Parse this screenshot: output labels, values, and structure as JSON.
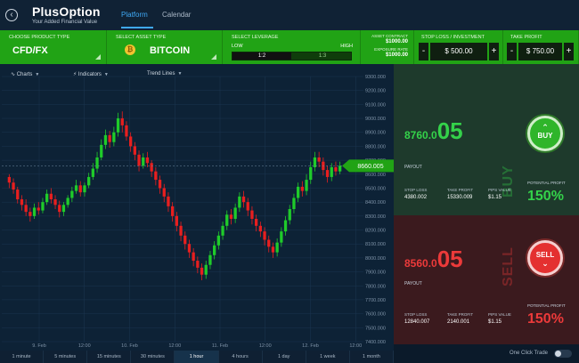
{
  "header": {
    "logo_name": "PlusOption",
    "logo_tagline": "Your Added Financial Value",
    "tabs": [
      {
        "label": "Platform",
        "active": true
      },
      {
        "label": "Calendar",
        "active": false
      }
    ]
  },
  "controls": {
    "product": {
      "label": "CHOOSE PRODUCT TYPE",
      "value": "CFD/FX"
    },
    "asset": {
      "label": "SELECT ASSET TYPE",
      "value": "BITCOIN",
      "icon": "bitcoin-coin-icon"
    },
    "leverage": {
      "label": "SELECT LEVERAGE",
      "low": "LOW",
      "high": "HIGH",
      "selected": "1:2",
      "other": "1:3"
    },
    "asset_contract": {
      "label": "ASSET CONTRACT",
      "value": "$1000.00",
      "exposure_label": "EXPOSURE RATE",
      "exposure_value": "$1000.00"
    },
    "stop_loss": {
      "label": "STOP LOSS / INVESTMENT",
      "value": "$ 500.00",
      "minus": "-",
      "plus": "+"
    },
    "take_profit": {
      "label": "TAKE PROFIT",
      "value": "$ 750.00",
      "minus": "-",
      "plus": "+"
    }
  },
  "toolbar": {
    "charts": "Charts",
    "indicators": "Indicators",
    "trend_lines": "Trend Lines"
  },
  "chart_data": {
    "type": "candlestick",
    "y_ticks": [
      "9300.000",
      "9200.000",
      "9100.000",
      "9000.000",
      "8900.000",
      "8800.000",
      "8700.000",
      "8600.000",
      "8500.000",
      "8400.000",
      "8300.000",
      "8200.000",
      "8100.000",
      "8000.000",
      "7900.000",
      "7800.000",
      "7700.000",
      "7600.000",
      "7500.000",
      "7400.000"
    ],
    "x_ticks": [
      "9. Feb",
      "12:00",
      "10. Feb",
      "12:00",
      "11. Feb",
      "12:00",
      "12. Feb",
      "12:00"
    ],
    "ylim": [
      7400,
      9300
    ],
    "current_price": "8660.005",
    "colors": {
      "up": "#1fcb2a",
      "down": "#e81f1f",
      "marker": "#21a315"
    },
    "candles": [
      [
        8580,
        8540,
        8600,
        8500
      ],
      [
        8540,
        8490,
        8570,
        8460
      ],
      [
        8490,
        8420,
        8510,
        8390
      ],
      [
        8420,
        8380,
        8450,
        8340
      ],
      [
        8380,
        8330,
        8420,
        8300
      ],
      [
        8330,
        8300,
        8360,
        8260
      ],
      [
        8300,
        8360,
        8390,
        8280
      ],
      [
        8360,
        8340,
        8400,
        8310
      ],
      [
        8340,
        8400,
        8430,
        8320
      ],
      [
        8400,
        8460,
        8490,
        8380
      ],
      [
        8460,
        8420,
        8500,
        8390
      ],
      [
        8420,
        8380,
        8450,
        8350
      ],
      [
        8380,
        8330,
        8410,
        8290
      ],
      [
        8330,
        8380,
        8400,
        8300
      ],
      [
        8380,
        8430,
        8450,
        8360
      ],
      [
        8430,
        8480,
        8510,
        8400
      ],
      [
        8480,
        8520,
        8560,
        8460
      ],
      [
        8520,
        8470,
        8550,
        8440
      ],
      [
        8470,
        8520,
        8540,
        8440
      ],
      [
        8520,
        8580,
        8610,
        8500
      ],
      [
        8580,
        8640,
        8680,
        8560
      ],
      [
        8640,
        8720,
        8760,
        8610
      ],
      [
        8720,
        8810,
        8850,
        8700
      ],
      [
        8810,
        8880,
        8920,
        8780
      ],
      [
        8880,
        8830,
        8910,
        8790
      ],
      [
        8830,
        8900,
        8940,
        8800
      ],
      [
        8900,
        9000,
        9040,
        8870
      ],
      [
        9000,
        8950,
        9050,
        8900
      ],
      [
        8950,
        8870,
        8980,
        8840
      ],
      [
        8870,
        8800,
        8900,
        8760
      ],
      [
        8800,
        8740,
        8830,
        8700
      ],
      [
        8740,
        8660,
        8770,
        8620
      ],
      [
        8660,
        8720,
        8750,
        8640
      ],
      [
        8720,
        8680,
        8760,
        8650
      ],
      [
        8680,
        8620,
        8700,
        8580
      ],
      [
        8620,
        8560,
        8650,
        8520
      ],
      [
        8560,
        8500,
        8590,
        8460
      ],
      [
        8500,
        8440,
        8530,
        8400
      ],
      [
        8440,
        8370,
        8470,
        8330
      ],
      [
        8370,
        8300,
        8400,
        8260
      ],
      [
        8300,
        8230,
        8330,
        8190
      ],
      [
        8230,
        8160,
        8260,
        8120
      ],
      [
        8160,
        8100,
        8190,
        8060
      ],
      [
        8100,
        8040,
        8130,
        8000
      ],
      [
        8040,
        7980,
        8070,
        7940
      ],
      [
        7980,
        7930,
        8010,
        7890
      ],
      [
        7930,
        7880,
        7960,
        7840
      ],
      [
        7880,
        7950,
        7980,
        7850
      ],
      [
        7950,
        8020,
        8050,
        7920
      ],
      [
        8020,
        8090,
        8120,
        7990
      ],
      [
        8090,
        8160,
        8190,
        8060
      ],
      [
        8160,
        8230,
        8260,
        8130
      ],
      [
        8230,
        8310,
        8340,
        8200
      ],
      [
        8310,
        8280,
        8350,
        8240
      ],
      [
        8280,
        8360,
        8390,
        8250
      ],
      [
        8360,
        8440,
        8470,
        8330
      ],
      [
        8440,
        8400,
        8480,
        8360
      ],
      [
        8400,
        8340,
        8430,
        8300
      ],
      [
        8340,
        8280,
        8370,
        8240
      ],
      [
        8280,
        8230,
        8310,
        8190
      ],
      [
        8230,
        8190,
        8260,
        8150
      ],
      [
        8190,
        8130,
        8220,
        8090
      ],
      [
        8130,
        8080,
        8160,
        8040
      ],
      [
        8080,
        8040,
        8110,
        8000
      ],
      [
        8040,
        8110,
        8140,
        8010
      ],
      [
        8110,
        8190,
        8220,
        8080
      ],
      [
        8190,
        8270,
        8300,
        8160
      ],
      [
        8270,
        8350,
        8380,
        8240
      ],
      [
        8350,
        8430,
        8460,
        8320
      ],
      [
        8430,
        8510,
        8540,
        8400
      ],
      [
        8510,
        8480,
        8550,
        8440
      ],
      [
        8480,
        8560,
        8600,
        8450
      ],
      [
        8560,
        8650,
        8690,
        8530
      ],
      [
        8650,
        8720,
        8760,
        8620
      ],
      [
        8720,
        8690,
        8760,
        8650
      ],
      [
        8690,
        8630,
        8720,
        8590
      ],
      [
        8630,
        8580,
        8660,
        8540
      ],
      [
        8580,
        8650,
        8680,
        8550
      ],
      [
        8650,
        8620,
        8690,
        8590
      ],
      [
        8620,
        8660,
        8690,
        8600
      ]
    ]
  },
  "timeframes": [
    {
      "label": "1 minute",
      "active": false
    },
    {
      "label": "5 minutes",
      "active": false
    },
    {
      "label": "15 minutes",
      "active": false
    },
    {
      "label": "30 minutes",
      "active": false
    },
    {
      "label": "1 hour",
      "active": true
    },
    {
      "label": "4 hours",
      "active": false
    },
    {
      "label": "1 day",
      "active": false
    },
    {
      "label": "1 week",
      "active": false
    },
    {
      "label": "1 month",
      "active": false
    }
  ],
  "buy": {
    "price_small": "8760.0",
    "price_large": "05",
    "side_word": "BUY",
    "payout": "PAYOUT",
    "stop_loss_label": "STOP LOSS",
    "stop_loss_value": "4380.002",
    "take_profit_label": "TAKE PROFIT",
    "take_profit_value": "15330.009",
    "pips_label": "PIPS VALUE",
    "pips_value": "$1.15",
    "potential_label": "POTENTIAL PROFIT",
    "potential_value": "150%",
    "button_label": "BUY"
  },
  "sell": {
    "price_small": "8560.0",
    "price_large": "05",
    "side_word": "SELL",
    "payout": "PAYOUT",
    "stop_loss_label": "STOP LOSS",
    "stop_loss_value": "12840.007",
    "take_profit_label": "TAKE PROFIT",
    "take_profit_value": "2140.001",
    "pips_label": "PIPS VALUE",
    "pips_value": "$1.15",
    "potential_label": "POTENTIAL PROFIT",
    "potential_value": "150%",
    "button_label": "SELL"
  },
  "one_click": {
    "label": "One Click Trade",
    "enabled": false
  }
}
